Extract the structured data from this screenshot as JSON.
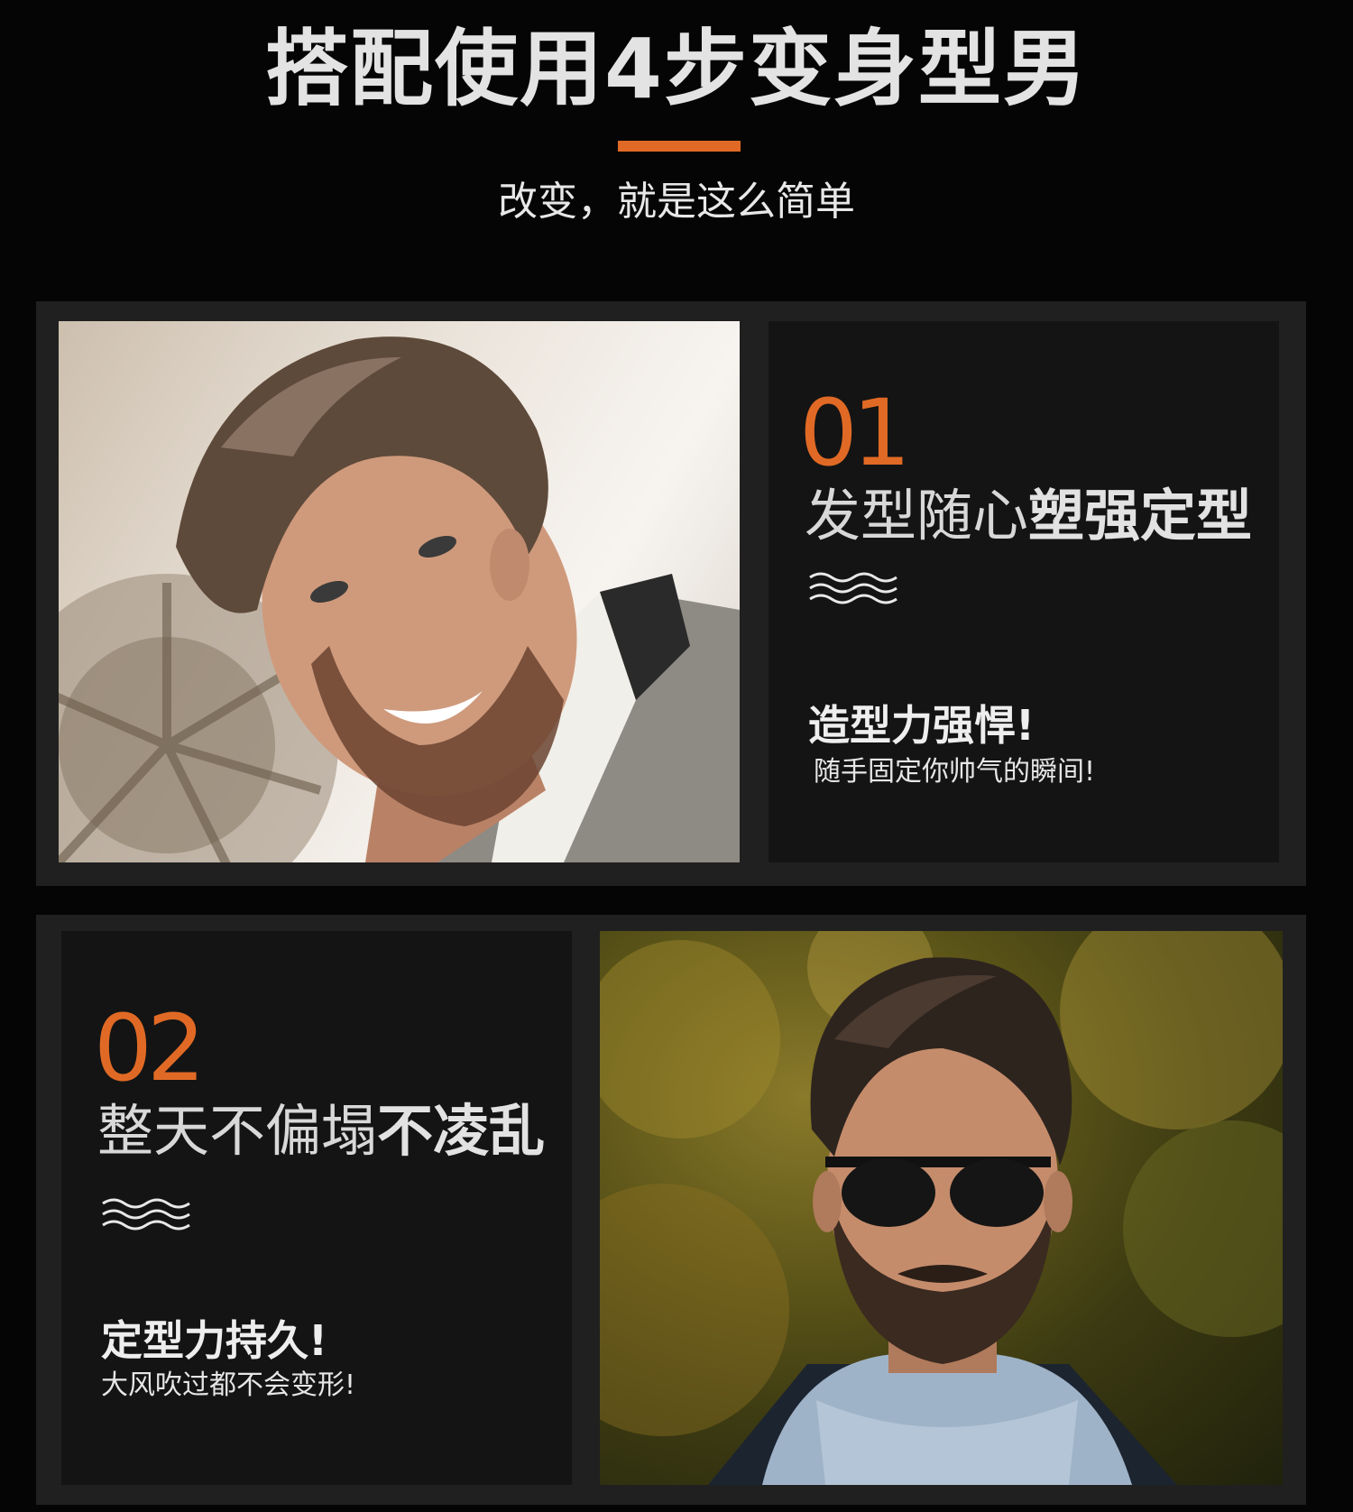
{
  "header": {
    "title": "搭配使用4步变身型男",
    "subtitle": "改变，就是这么简单",
    "accent_color": "#e06a25"
  },
  "steps": [
    {
      "number": "01",
      "title_regular": "发型随心",
      "title_bold": "塑强定型",
      "divider_icon": "wave-lines-icon",
      "point": "造型力强悍!",
      "detail": "随手固定你帅气的瞬间!"
    },
    {
      "number": "02",
      "title_regular": "整天不偏塌",
      "title_bold": "不凌乱",
      "divider_icon": "wave-lines-icon",
      "point": "定型力持久!",
      "detail": "大风吹过都不会变形!"
    }
  ]
}
